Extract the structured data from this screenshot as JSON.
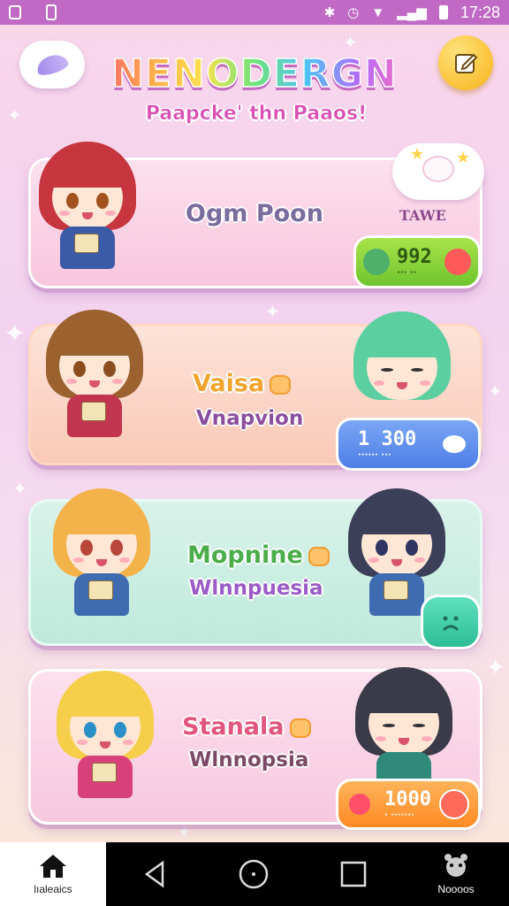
{
  "status_bar": {
    "time": "17:28"
  },
  "header": {
    "title": "NENODERGN",
    "subtitle": "Paapcke' thn Paaos!",
    "icons": [
      "cloud-leaf-icon",
      "edit-icon"
    ]
  },
  "cards": [
    {
      "name": "Ogm Poon",
      "tag": "TAWE",
      "pill_value": "992",
      "pill_sub": "··· ··",
      "accent": "#8bd13b"
    },
    {
      "name": "Vaisa",
      "subname": "Vnapvion",
      "pill_value": "1 300",
      "pill_sub": "······ ···",
      "accent": "#5a89ec"
    },
    {
      "name": "Mopnine",
      "subname": "Wlnnpuesia",
      "accent": "#3dd0a8"
    },
    {
      "name": "Stanala",
      "subname": "Wlnnopsia",
      "pill_value": "1000",
      "pill_sub": "· ·······",
      "accent": "#ff9a30"
    }
  ],
  "bottom_nav": {
    "home_label": "lıaleaics",
    "right_label": "Noooos"
  }
}
